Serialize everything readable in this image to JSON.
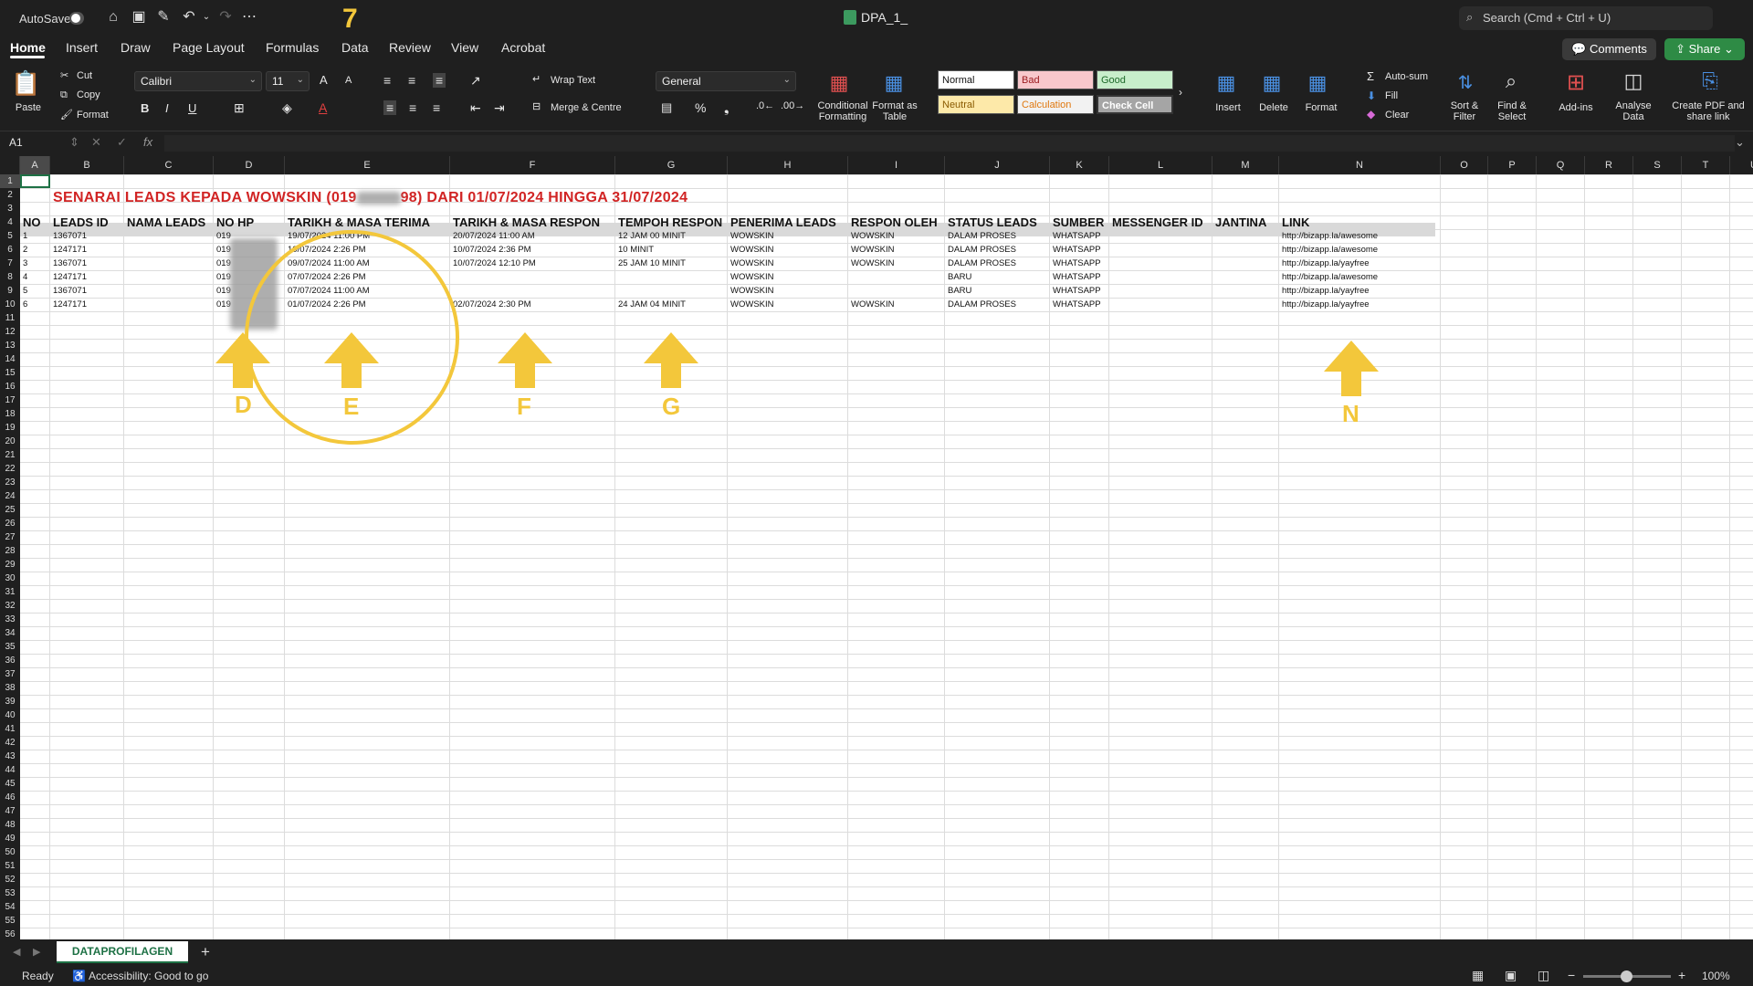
{
  "titlebar": {
    "autosave_label": "AutoSave",
    "filename": "DPA_1_",
    "search_placeholder": "Search (Cmd + Ctrl + U)",
    "step_number": "7"
  },
  "tabs": [
    "Home",
    "Insert",
    "Draw",
    "Page Layout",
    "Formulas",
    "Data",
    "Review",
    "View",
    "Acrobat"
  ],
  "actions": {
    "comments": "Comments",
    "share": "Share"
  },
  "ribbon": {
    "paste": "Paste",
    "cut": "Cut",
    "copy": "Copy",
    "format": "Format",
    "font_name": "Calibri",
    "font_size": "11",
    "wrap_text": "Wrap Text",
    "merge_centre": "Merge & Centre",
    "number_format": "General",
    "conditional_formatting": "Conditional Formatting",
    "format_as_table": "Format as Table",
    "styles": {
      "normal": "Normal",
      "bad": "Bad",
      "good": "Good",
      "neutral": "Neutral",
      "calculation": "Calculation",
      "check_cell": "Check Cell"
    },
    "insert": "Insert",
    "delete": "Delete",
    "format_cells": "Format",
    "autosum": "Auto-sum",
    "fill": "Fill",
    "clear": "Clear",
    "sort_filter": "Sort & Filter",
    "find_select": "Find & Select",
    "addins": "Add-ins",
    "analyse_data": "Analyse Data",
    "create_pdf": "Create PDF and share link"
  },
  "formula_bar": {
    "name_box": "A1",
    "fx": "fx"
  },
  "sheet": {
    "columns": [
      "A",
      "B",
      "C",
      "D",
      "E",
      "F",
      "G",
      "H",
      "I",
      "J",
      "K",
      "L",
      "M",
      "N",
      "O",
      "P",
      "Q",
      "R",
      "S",
      "T",
      "U"
    ],
    "title": "SENARAI LEADS KEPADA WOWSKIN (019",
    "title_end": "98) DARI 01/07/2024 HINGGA 31/07/2024",
    "headers": [
      "NO",
      "LEADS ID",
      "NAMA LEADS",
      "NO HP",
      "TARIKH & MASA TERIMA",
      "TARIKH & MASA RESPON",
      "TEMPOH RESPON",
      "PENERIMA LEADS",
      "RESPON OLEH",
      "STATUS LEADS",
      "SUMBER",
      "MESSENGER ID",
      "JANTINA",
      "LINK"
    ],
    "rows": [
      [
        "1",
        "1367071",
        "",
        "019",
        "19/07/2024 11:00 PM",
        "20/07/2024 11:00 AM",
        "12 JAM 00 MINIT",
        "WOWSKIN",
        "WOWSKIN",
        "DALAM PROSES",
        "WHATSAPP",
        "",
        "",
        "http://bizapp.la/awesome"
      ],
      [
        "2",
        "1247171",
        "",
        "019",
        "10/07/2024 2:26 PM",
        "10/07/2024 2:36 PM",
        "10 MINIT",
        "WOWSKIN",
        "WOWSKIN",
        "DALAM PROSES",
        "WHATSAPP",
        "",
        "",
        "http://bizapp.la/awesome"
      ],
      [
        "3",
        "1367071",
        "",
        "019",
        "09/07/2024 11:00 AM",
        "10/07/2024 12:10 PM",
        "25 JAM 10 MINIT",
        "WOWSKIN",
        "WOWSKIN",
        "DALAM PROSES",
        "WHATSAPP",
        "",
        "",
        "http://bizapp.la/yayfree"
      ],
      [
        "4",
        "1247171",
        "",
        "019",
        "07/07/2024 2:26 PM",
        "",
        "",
        "WOWSKIN",
        "",
        "BARU",
        "WHATSAPP",
        "",
        "",
        "http://bizapp.la/awesome"
      ],
      [
        "5",
        "1367071",
        "",
        "019",
        "07/07/2024 11:00 AM",
        "",
        "",
        "WOWSKIN",
        "",
        "BARU",
        "WHATSAPP",
        "",
        "",
        "http://bizapp.la/yayfree"
      ],
      [
        "6",
        "1247171",
        "",
        "019",
        "01/07/2024 2:26 PM",
        "02/07/2024 2:30 PM",
        "24 JAM 04 MINIT",
        "WOWSKIN",
        "WOWSKIN",
        "DALAM PROSES",
        "WHATSAPP",
        "",
        "",
        "http://bizapp.la/yayfree"
      ]
    ],
    "annotation_letters": [
      "D",
      "E",
      "F",
      "G",
      "N"
    ]
  },
  "sheet_tab": "DATAPROFILAGEN",
  "status": {
    "ready": "Ready",
    "accessibility": "Accessibility: Good to go",
    "zoom": "100%"
  }
}
